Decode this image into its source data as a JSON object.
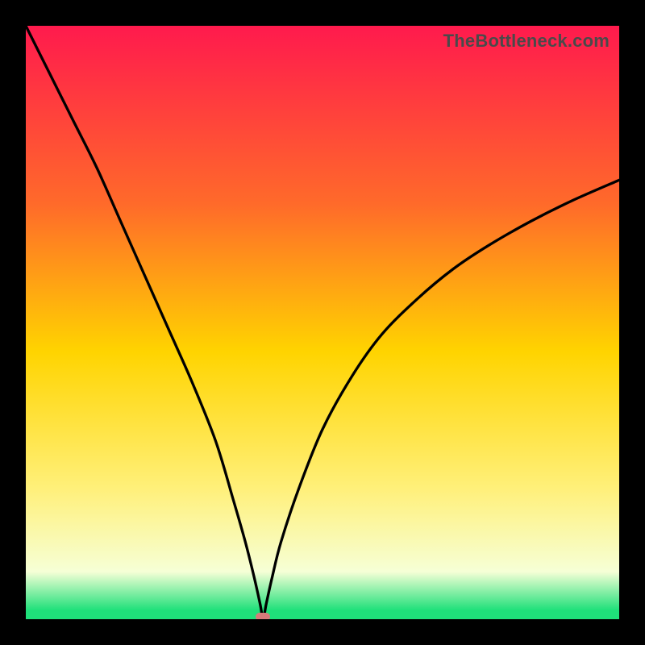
{
  "branding": "TheBottleneck.com",
  "colors": {
    "top": "#ff1a4d",
    "mid_upper": "#ff6a2a",
    "mid": "#ffd400",
    "mid_lower": "#fff07a",
    "near_bottom": "#f6ffd6",
    "bottom": "#1fe07a",
    "marker": "#d77a7a",
    "curve": "#000000"
  },
  "gradient_stops": [
    {
      "offset": 0.0,
      "color": "#ff1a4d"
    },
    {
      "offset": 0.3,
      "color": "#ff6a2a"
    },
    {
      "offset": 0.55,
      "color": "#ffd400"
    },
    {
      "offset": 0.78,
      "color": "#fff07a"
    },
    {
      "offset": 0.92,
      "color": "#f6ffd6"
    },
    {
      "offset": 0.985,
      "color": "#1fe07a"
    },
    {
      "offset": 1.0,
      "color": "#1fe07a"
    }
  ],
  "chart_data": {
    "type": "line",
    "title": "",
    "xlabel": "",
    "ylabel": "",
    "xlim": [
      0,
      100
    ],
    "ylim": [
      0,
      100
    ],
    "min_marker": {
      "x": 40,
      "y": 0
    },
    "series": [
      {
        "name": "bottleneck-curve",
        "x": [
          0,
          4,
          8,
          12,
          16,
          20,
          24,
          28,
          32,
          35,
          37,
          38.5,
          39.5,
          40,
          40.5,
          41.5,
          43,
          46,
          50,
          55,
          60,
          66,
          72,
          78,
          85,
          92,
          100
        ],
        "y": [
          100,
          92,
          84,
          76,
          67,
          58,
          49,
          40,
          30,
          20,
          13,
          7,
          2.5,
          0,
          2.5,
          7,
          13,
          22,
          32,
          41,
          48,
          54,
          59,
          63,
          67,
          70.5,
          74
        ]
      }
    ]
  }
}
